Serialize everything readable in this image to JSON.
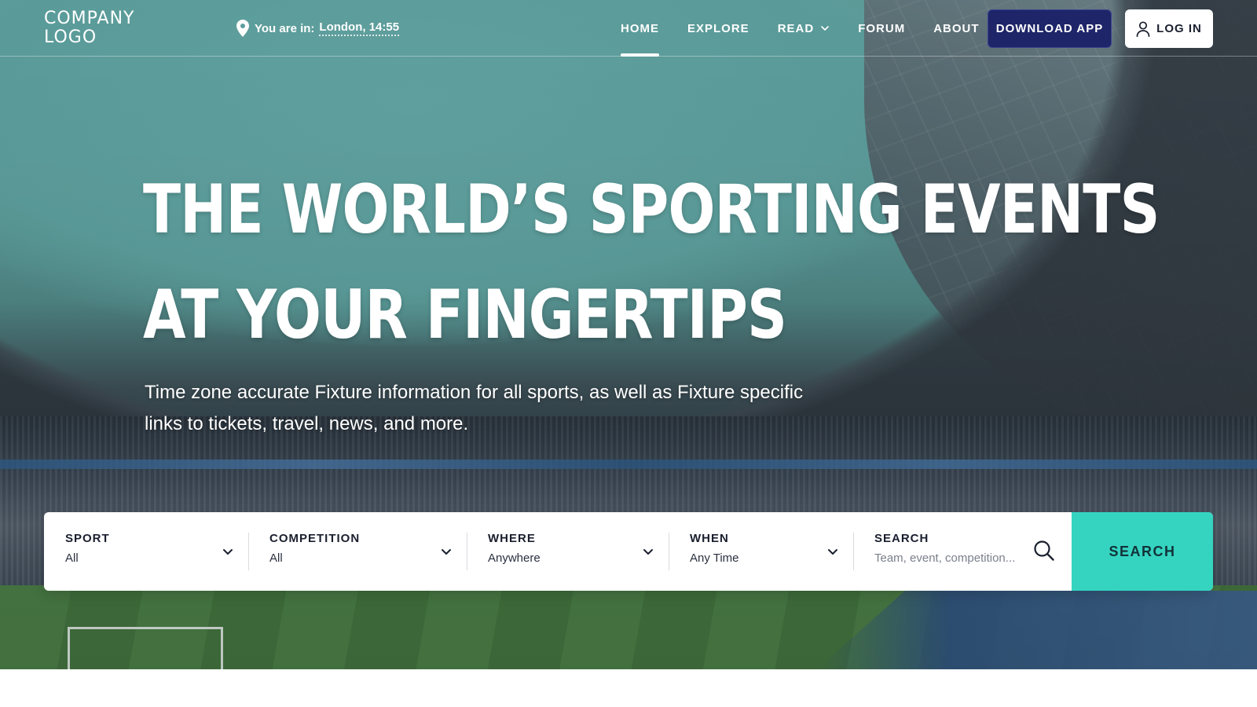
{
  "header": {
    "logo_line1": "COMPANY",
    "logo_line2": "LOGO",
    "location_prefix": "You are in:",
    "location_value": "London, 14:55",
    "nav": [
      {
        "label": "HOME",
        "active": true
      },
      {
        "label": "EXPLORE",
        "active": false
      },
      {
        "label": "READ",
        "active": false,
        "has_dropdown": true
      },
      {
        "label": "FORUM",
        "active": false
      },
      {
        "label": "ABOUT",
        "active": false
      }
    ],
    "download_label": "DOWNLOAD APP",
    "login_label": "LOG IN"
  },
  "hero": {
    "headline_line1": "THE WORLD’S SPORTING EVENTS",
    "headline_line2": "AT YOUR FINGERTIPS",
    "subhead": "Time zone accurate Fixture information for all sports, as well as Fixture specific links to tickets, travel, news, and more."
  },
  "search": {
    "fields": [
      {
        "label": "SPORT",
        "value": "All"
      },
      {
        "label": "COMPETITION",
        "value": "All"
      },
      {
        "label": "WHERE",
        "value": "Anywhere"
      },
      {
        "label": "WHEN",
        "value": "Any Time"
      }
    ],
    "search_label": "SEARCH",
    "search_placeholder": "Team, event, competition...",
    "button_label": "SEARCH"
  },
  "icons": {
    "location": "map-pin-icon",
    "user": "user-icon",
    "chevron": "chevron-down-icon",
    "search": "magnifier-icon"
  },
  "colors": {
    "primary_dark": "#1e2568",
    "accent_teal": "#35d4c0",
    "text_dark": "#1a1f2e"
  }
}
